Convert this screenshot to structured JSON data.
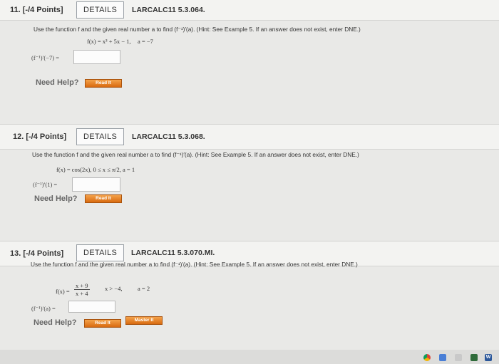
{
  "q11": {
    "number": "11.  [-/4 Points]",
    "details": "DETAILS",
    "code": "LARCALC11 5.3.064.",
    "prompt": "Use the function f and the given real number a to find (f⁻¹)′(a). (Hint: See Example 5. If an answer does not exist, enter DNE.)",
    "function": "f(x) = x³ + 5x − 1,",
    "a_value": "a = −7",
    "answer_label": "(f⁻¹)′(−7) =",
    "need_help": "Need Help?",
    "read_it": "Read It"
  },
  "q12": {
    "number": "12.  [-/4 Points]",
    "details": "DETAILS",
    "code": "LARCALC11 5.3.068.",
    "prompt": "Use the function f and the given real number a to find (f⁻¹)′(a). (Hint: See Example 5. If an answer does not exist, enter DNE.)",
    "function": "f(x) = cos(2x),   0 ≤ x ≤ π/2, a = 1",
    "answer_label": "(f⁻¹)′(1) =",
    "need_help": "Need Help?",
    "read_it": "Read It"
  },
  "q13": {
    "number": "13.  [-/4 Points]",
    "details": "DETAILS",
    "code": "LARCALC11 5.3.070.MI.",
    "prompt": "Use the function f and the given real number a to find (f⁻¹)′(a). (Hint: See Example 5. If an answer does not exist, enter DNE.)",
    "function_lhs": "f(x) =",
    "frac_num": "x + 9",
    "frac_den": "x + 4",
    "domain": "x > −4,",
    "a_value": "a = 2",
    "answer_label": "(f⁻¹)′(a) =",
    "need_help": "Need Help?",
    "read_it": "Read It",
    "master_it": "Master It"
  },
  "taskbar": {
    "icons": [
      "chrome-icon",
      "files-icon",
      "app-icon",
      "grid-icon",
      "word-icon"
    ],
    "word_letter": "W"
  }
}
